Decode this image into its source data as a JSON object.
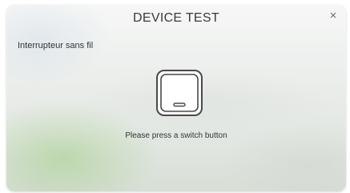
{
  "dialog": {
    "title": "DEVICE TEST",
    "close_symbol": "×",
    "device_name": "Interrupteur sans fil",
    "instruction": "Please press a switch button",
    "icon": "wall-switch-icon"
  }
}
